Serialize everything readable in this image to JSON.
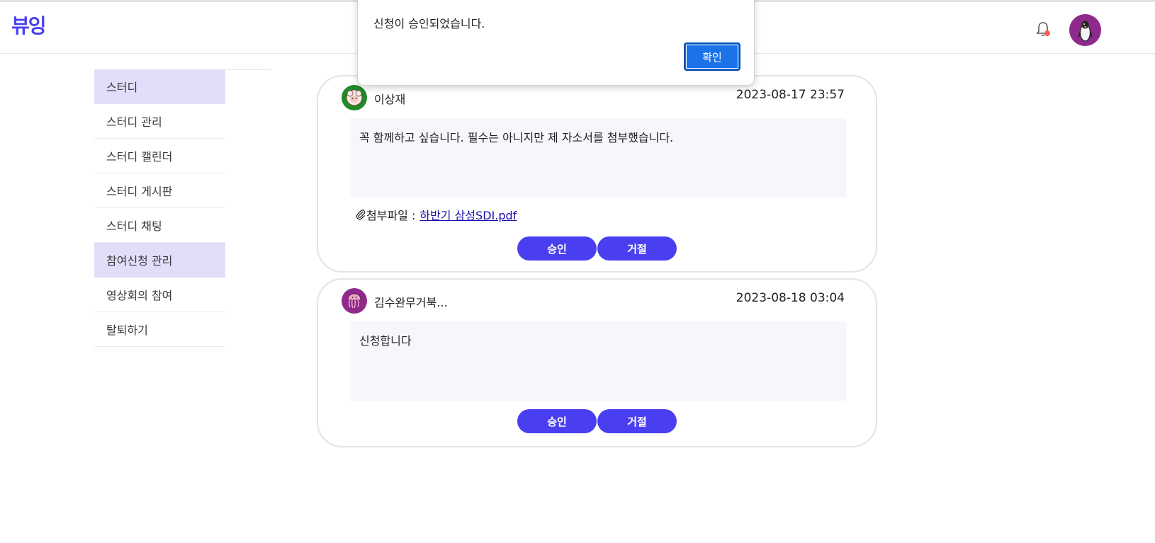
{
  "header": {
    "logo": "뷰잉",
    "notification_icon": "bell-icon",
    "profile_icon": "penguin-avatar-icon"
  },
  "sidebar": {
    "items": [
      {
        "label": "스터디",
        "active": true
      },
      {
        "label": "스터디 관리",
        "active": false
      },
      {
        "label": "스터디 캘린더",
        "active": false
      },
      {
        "label": "스터디 게시판",
        "active": false
      },
      {
        "label": "스터디 채팅",
        "active": false
      },
      {
        "label": "참여신청 관리",
        "active": true
      },
      {
        "label": "영상회의 참여",
        "active": false
      },
      {
        "label": "탈퇴하기",
        "active": false
      }
    ]
  },
  "applications": [
    {
      "name": "이상재",
      "date": "2023-08-17 23:57",
      "message": "꼭 함께하고 싶습니다. 필수는 아니지만 제 자소서를 첨부했습니다.",
      "attachment_label": "첨부파일 :",
      "attachment_file": "하반기 삼성SDI.pdf",
      "approve_label": "승인",
      "reject_label": "거절",
      "avatar_icon": "sheep-avatar-icon",
      "avatar_color": "#1f8a2a"
    },
    {
      "name": "김수완무거북...",
      "date": "2023-08-18 03:04",
      "message": "신청합니다",
      "approve_label": "승인",
      "reject_label": "거절",
      "avatar_icon": "jellyfish-avatar-icon",
      "avatar_color": "#8e2a8c"
    }
  ],
  "dialog": {
    "message": "신청이 승인되었습니다.",
    "ok_label": "확인"
  },
  "colors": {
    "accent": "#4a3ff0",
    "active_menu": "#e1defa",
    "dialog_button": "#1a73e8"
  }
}
